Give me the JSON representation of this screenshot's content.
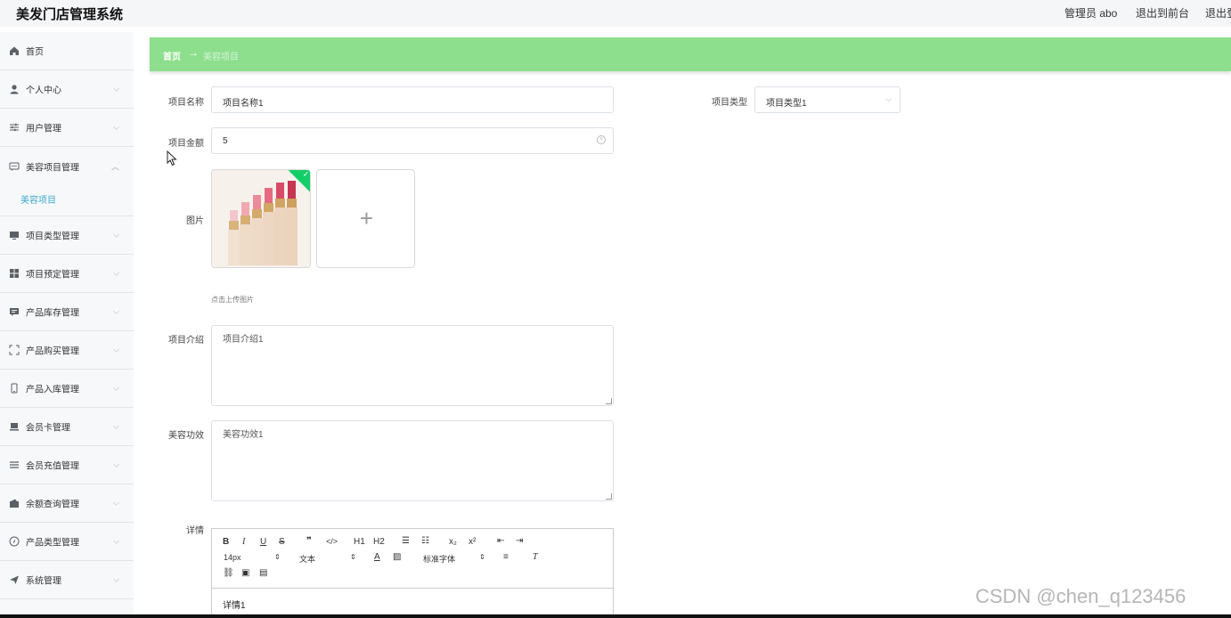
{
  "header": {
    "title": "美发门店管理系统",
    "admin": "管理员 abo",
    "back_front": "退出到前台",
    "logout": "退出登录"
  },
  "sidebar": {
    "items": [
      {
        "label": "首页",
        "icon": "home-icon"
      },
      {
        "label": "个人中心",
        "icon": "user-icon"
      },
      {
        "label": "用户管理",
        "icon": "sliders-icon"
      },
      {
        "label": "美容项目管理",
        "icon": "chat-icon"
      },
      {
        "label": "项目类型管理",
        "icon": "monitor-icon"
      },
      {
        "label": "项目预定管理",
        "icon": "grid-icon"
      },
      {
        "label": "产品库存管理",
        "icon": "message-icon"
      },
      {
        "label": "产品购买管理",
        "icon": "scan-icon"
      },
      {
        "label": "产品入库管理",
        "icon": "phone-icon"
      },
      {
        "label": "会员卡管理",
        "icon": "card-icon"
      },
      {
        "label": "会员充值管理",
        "icon": "list-icon"
      },
      {
        "label": "余额查询管理",
        "icon": "wallet-icon"
      },
      {
        "label": "产品类型管理",
        "icon": "compass-icon"
      },
      {
        "label": "系统管理",
        "icon": "send-icon"
      }
    ],
    "subitem": "美容项目"
  },
  "breadcrumb": {
    "home": "首页",
    "arrow": "→",
    "current": "美容项目"
  },
  "form": {
    "name_label": "项目名称",
    "name_value": "项目名称1",
    "type_label": "项目类型",
    "type_value": "项目类型1",
    "price_label": "项目金额",
    "price_value": "5",
    "image_label": "图片",
    "upload_hint": "点击上传图片",
    "intro_label": "项目介绍",
    "intro_value": "项目介绍1",
    "effect_label": "美容功效",
    "effect_value": "美容功效1",
    "detail_label": "详情",
    "detail_value": "详情1"
  },
  "editor": {
    "font_size": "14px",
    "block_type": "文本",
    "font_family": "标准字体",
    "h1": "H1",
    "h2": "H2"
  },
  "watermark": "CSDN @chen_q123456"
}
